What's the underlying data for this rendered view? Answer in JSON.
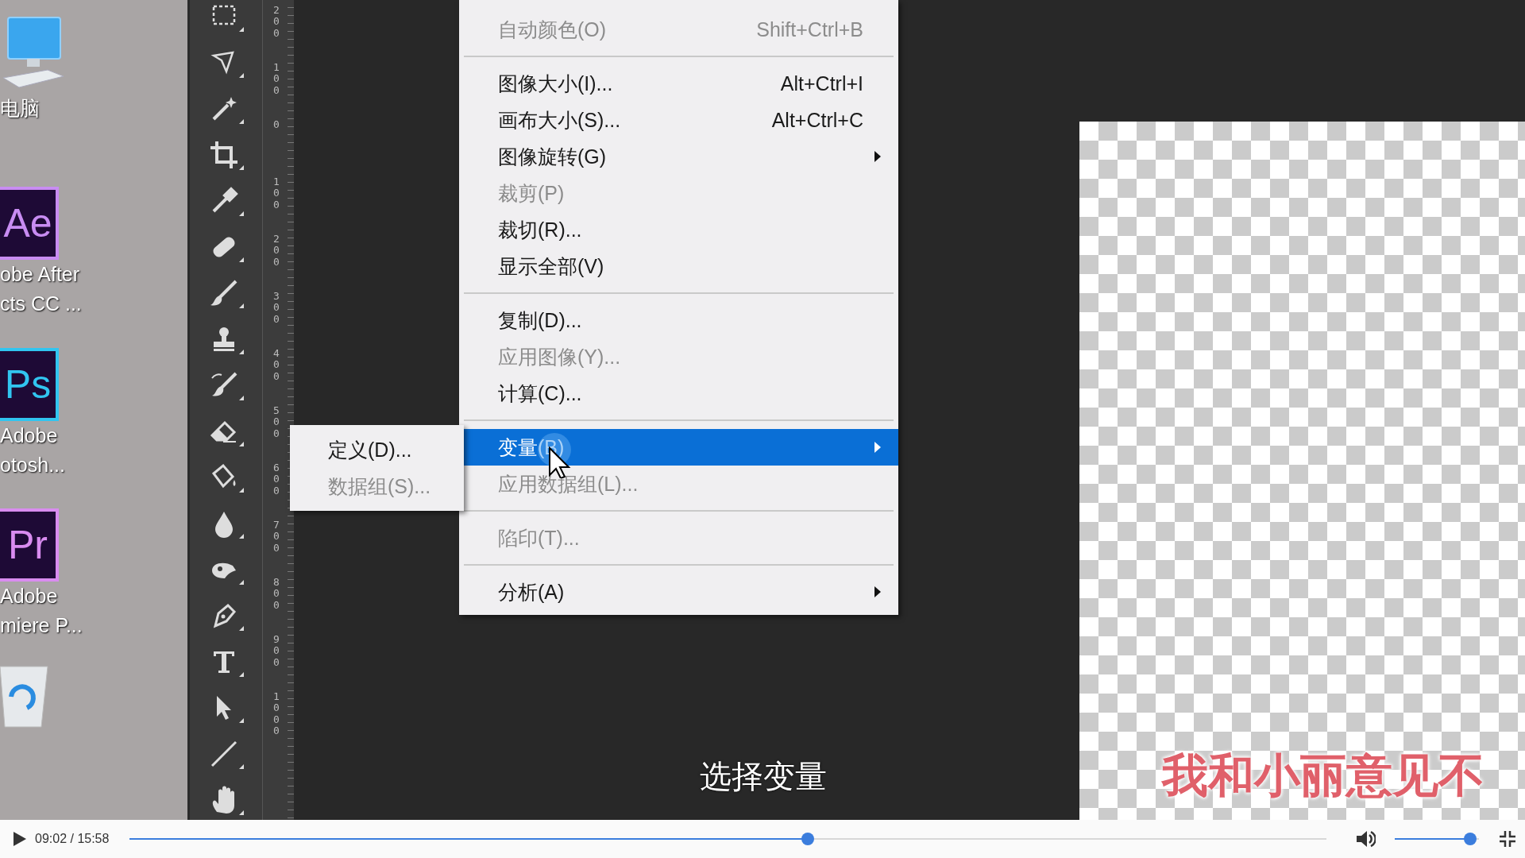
{
  "desktop_icons": [
    {
      "kind": "computer",
      "label_lines": [
        "电脑"
      ]
    },
    {
      "kind": "app",
      "badge": "Ae",
      "color": "#c88cf2",
      "label_lines": [
        "obe After",
        "cts CC ..."
      ]
    },
    {
      "kind": "app",
      "badge": "Ps",
      "color": "#31c5f0",
      "label_lines": [
        "Adobe",
        "otosh..."
      ]
    },
    {
      "kind": "app",
      "badge": "Pr",
      "color": "#d98cf0",
      "label_lines": [
        "Adobe",
        "miere P..."
      ]
    },
    {
      "kind": "recycle"
    }
  ],
  "ruler": {
    "labels": [
      "200",
      "100",
      "0",
      "100",
      "200",
      "300",
      "400",
      "500",
      "600",
      "700",
      "800",
      "900",
      "1000"
    ]
  },
  "image_menu": {
    "items": [
      {
        "kind": "item",
        "label": "自动颜色(O)",
        "shortcut": "Shift+Ctrl+B",
        "disabled": true,
        "submenu": false,
        "selected": false
      },
      {
        "kind": "separator"
      },
      {
        "kind": "item",
        "label": "图像大小(I)...",
        "shortcut": "Alt+Ctrl+I",
        "disabled": false,
        "submenu": false,
        "selected": false
      },
      {
        "kind": "item",
        "label": "画布大小(S)...",
        "shortcut": "Alt+Ctrl+C",
        "disabled": false,
        "submenu": false,
        "selected": false
      },
      {
        "kind": "item",
        "label": "图像旋转(G)",
        "disabled": false,
        "submenu": true,
        "selected": false
      },
      {
        "kind": "item",
        "label": "裁剪(P)",
        "disabled": true,
        "submenu": false,
        "selected": false
      },
      {
        "kind": "item",
        "label": "裁切(R)...",
        "disabled": false,
        "submenu": false,
        "selected": false
      },
      {
        "kind": "item",
        "label": "显示全部(V)",
        "disabled": false,
        "submenu": false,
        "selected": false
      },
      {
        "kind": "separator"
      },
      {
        "kind": "item",
        "label": "复制(D)...",
        "disabled": false,
        "submenu": false,
        "selected": false
      },
      {
        "kind": "item",
        "label": "应用图像(Y)...",
        "disabled": true,
        "submenu": false,
        "selected": false
      },
      {
        "kind": "item",
        "label": "计算(C)...",
        "disabled": false,
        "submenu": false,
        "selected": false
      },
      {
        "kind": "separator"
      },
      {
        "kind": "item",
        "label": "变量(B)",
        "disabled": false,
        "submenu": true,
        "selected": true
      },
      {
        "kind": "item",
        "label": "应用数据组(L)...",
        "disabled": true,
        "submenu": false,
        "selected": false
      },
      {
        "kind": "separator"
      },
      {
        "kind": "item",
        "label": "陷印(T)...",
        "disabled": true,
        "submenu": false,
        "selected": false
      },
      {
        "kind": "separator"
      },
      {
        "kind": "item",
        "label": "分析(A)",
        "disabled": false,
        "submenu": true,
        "selected": false
      }
    ]
  },
  "variables_submenu": {
    "items": [
      {
        "kind": "item",
        "label": "定义(D)...",
        "disabled": false,
        "submenu": false,
        "selected": false
      },
      {
        "kind": "item",
        "label": "数据组(S)...",
        "disabled": true,
        "submenu": false,
        "selected": false
      }
    ]
  },
  "canvas": {
    "text": "我和小丽意见不"
  },
  "subtitle": "选择变量",
  "player": {
    "playing": false,
    "time": "09:02 / 15:58",
    "progress": {
      "level": 0.567
    },
    "volume": {
      "level": 0.97
    }
  }
}
